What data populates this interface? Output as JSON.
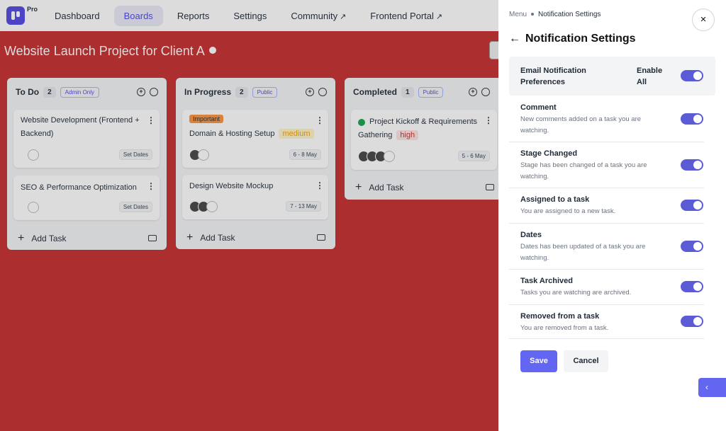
{
  "nav": {
    "pro_badge": "Pro",
    "items": [
      {
        "label": "Dashboard",
        "external": false
      },
      {
        "label": "Boards",
        "external": false,
        "active": true
      },
      {
        "label": "Reports",
        "external": false
      },
      {
        "label": "Settings",
        "external": false
      },
      {
        "label": "Community",
        "external": true
      },
      {
        "label": "Frontend Portal",
        "external": true
      }
    ],
    "external_icon": "↗"
  },
  "board": {
    "title": "Website Launch Project for Client A",
    "background_color": "#c62b2b",
    "columns": [
      {
        "name": "To Do",
        "count": "2",
        "visibility": "Admin Only",
        "cards": [
          {
            "title": "Website Development (Frontend + Backend)",
            "date": "Set Dates"
          },
          {
            "title": "SEO & Performance Optimization",
            "date": "Set Dates"
          }
        ],
        "add_label": "Add Task"
      },
      {
        "name": "In Progress",
        "count": "2",
        "visibility": "Public",
        "cards": [
          {
            "tag": "Important",
            "title": "Domain & Hosting Setup",
            "priority": "medium",
            "date": "6 - 8 May"
          },
          {
            "title": "Design Website Mockup",
            "date": "7 - 13 May"
          }
        ],
        "add_label": "Add Task"
      },
      {
        "name": "Completed",
        "count": "1",
        "visibility": "Public",
        "cards": [
          {
            "title": "Project Kickoff & Requirements Gathering",
            "priority": "high",
            "date": "5 - 6 May"
          }
        ],
        "add_label": "Add Task"
      }
    ]
  },
  "panel": {
    "breadcrumb_menu": "Menu",
    "breadcrumb_current": "Notification Settings",
    "title": "Notification Settings",
    "close_icon": "×",
    "back_icon": "←",
    "email_label": "Email Notification Preferences",
    "enable_all_label": "Enable All",
    "settings": [
      {
        "title": "Comment",
        "desc": "New comments added on a task you are watching."
      },
      {
        "title": "Stage Changed",
        "desc": "Stage has been changed of a task you are watching."
      },
      {
        "title": "Assigned to a task",
        "desc": "You are assigned to a new task."
      },
      {
        "title": "Dates",
        "desc": "Dates has been updated of a task you are watching."
      },
      {
        "title": "Task Archived",
        "desc": "Tasks you are watching are archived."
      },
      {
        "title": "Removed from a task",
        "desc": "You are removed from a task."
      }
    ],
    "save_label": "Save",
    "cancel_label": "Cancel",
    "side_tab_icon": "‹",
    "toggle_color": "#5b5bd6",
    "medium_color": "#f59e0b",
    "high_color": "#dc2626"
  }
}
